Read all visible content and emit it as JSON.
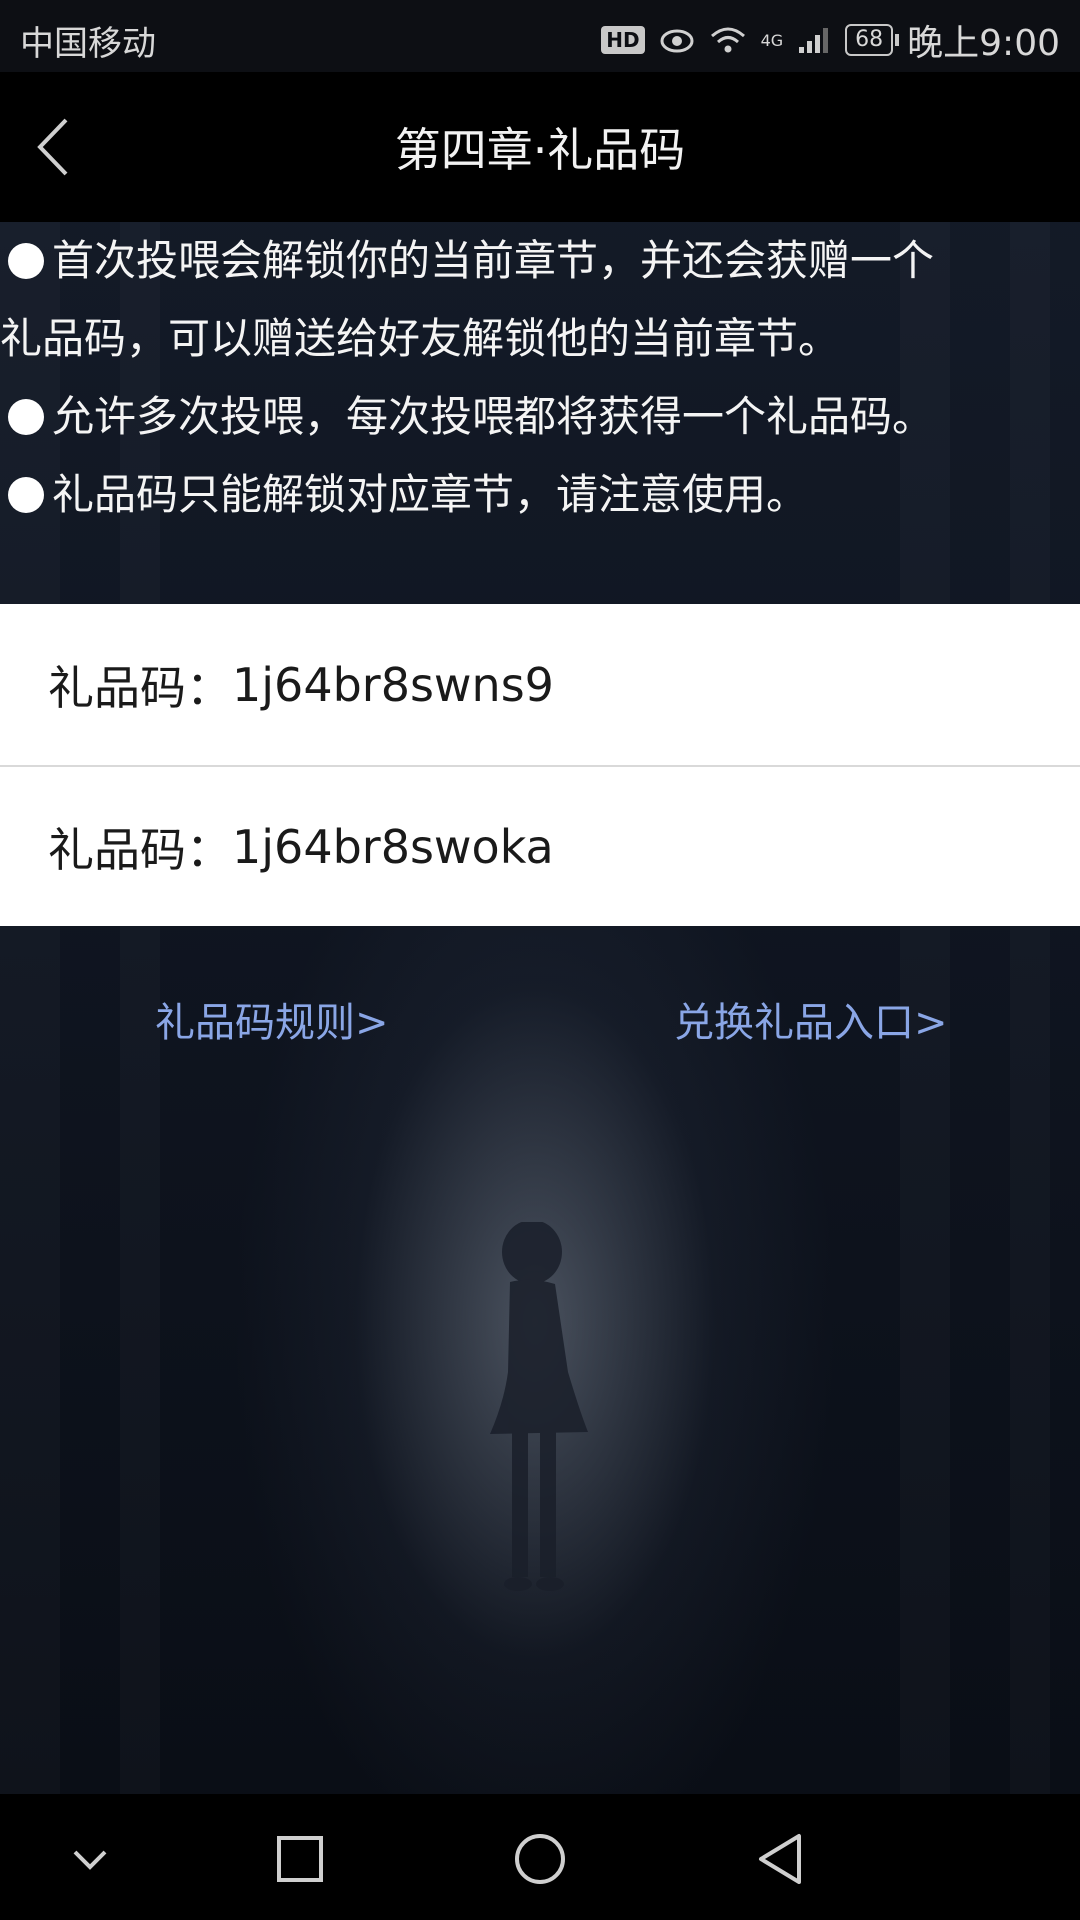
{
  "status_bar": {
    "carrier": "中国移动",
    "hd": "HD",
    "network": "4G",
    "battery": "68",
    "time": "晚上9:00"
  },
  "header": {
    "title": "第四章·礼品码"
  },
  "rules": {
    "line1": "首次投喂会解锁你的当前章节，并还会获赠一个",
    "line2": "礼品码，可以赠送给好友解锁他的当前章节。",
    "line3": "允许多次投喂，每次投喂都将获得一个礼品码。",
    "line4": "礼品码只能解锁对应章节，请注意使用。"
  },
  "gift_codes": [
    {
      "label": "礼品码：",
      "code": "1j64br8swns9"
    },
    {
      "label": "礼品码：",
      "code": "1j64br8swoka"
    }
  ],
  "links": {
    "rules_link": "礼品码规则>",
    "redeem_link": "兑换礼品入口>"
  },
  "colors": {
    "link": "#8aa6e6",
    "background": "#0b0f18"
  }
}
